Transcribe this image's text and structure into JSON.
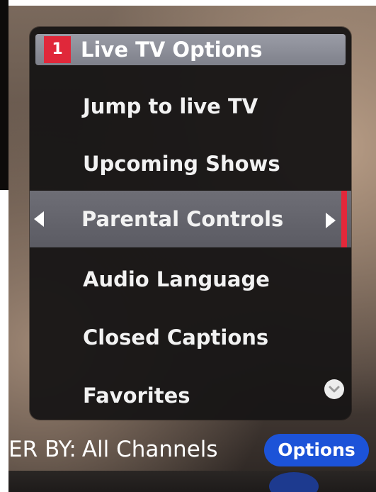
{
  "menu": {
    "badge": "1",
    "title": "Live TV Options",
    "items": [
      {
        "label": "Jump to live TV"
      },
      {
        "label": "Upcoming Shows"
      },
      {
        "label": "Parental Controls"
      },
      {
        "label": "Audio Language"
      },
      {
        "label": "Closed Captions"
      },
      {
        "label": "Favorites"
      }
    ],
    "selected_index": 2
  },
  "bottom_bar": {
    "filter_prefix": "ER BY:",
    "filter_value": "All Channels",
    "options_button": "Options"
  },
  "icons": {
    "left_arrow": "arrow-left-icon",
    "right_arrow": "arrow-right-icon",
    "scroll_down": "chevron-down-circle-icon"
  },
  "colors": {
    "badge": "#e0283a",
    "selection_bar": "#e3283a",
    "options_button": "#1c53d8",
    "header": "#8a8c96"
  }
}
